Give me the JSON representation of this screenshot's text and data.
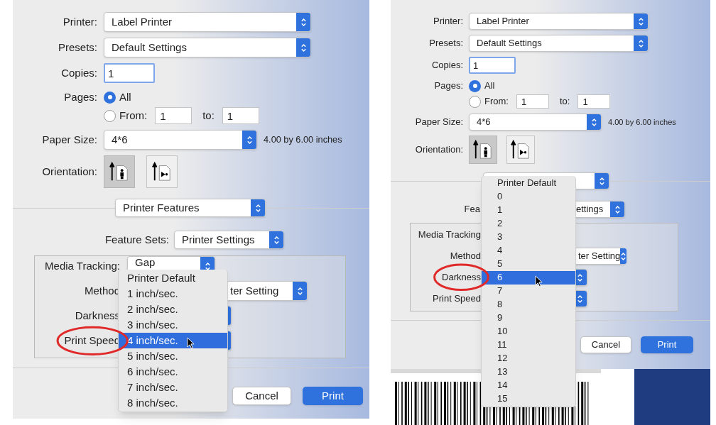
{
  "panels": [
    {
      "printer": {
        "label": "Printer:",
        "value": "Label Printer"
      },
      "presets": {
        "label": "Presets:",
        "value": "Default Settings"
      },
      "copies": {
        "label": "Copies:",
        "value": "1"
      },
      "pages": {
        "label": "Pages:",
        "options": [
          {
            "label": "All",
            "selected": true
          },
          {
            "label": "From:",
            "selected": false
          }
        ],
        "from": "1",
        "to_label": "to:",
        "to": "1"
      },
      "paper_size": {
        "label": "Paper Size:",
        "value": "4*6",
        "note": "4.00 by 6.00 inches"
      },
      "orientation": {
        "label": "Orientation:",
        "options": [
          {
            "kind": "portrait",
            "selected": true
          },
          {
            "kind": "landscape",
            "selected": false
          }
        ]
      },
      "section_popup": {
        "value": "Printer Features"
      },
      "feature_sets": {
        "label": "Feature Sets:",
        "value": "Printer Settings"
      },
      "settings": [
        {
          "label": "Media Tracking:",
          "value": "Gap",
          "circled": false
        },
        {
          "label": "Method",
          "value": "ter Setting",
          "circled": false
        },
        {
          "label": "Darkness",
          "circled": false
        },
        {
          "label": "Print Speed",
          "circled": true,
          "menu": {
            "items": [
              {
                "label": "Printer Default",
                "selected": false
              },
              {
                "label": "1 inch/sec.",
                "selected": false
              },
              {
                "label": "2 inch/sec.",
                "selected": false
              },
              {
                "label": "3 inch/sec.",
                "selected": false
              },
              {
                "label": "4 inch/sec.",
                "selected": true
              },
              {
                "label": "5 inch/sec.",
                "selected": false
              },
              {
                "label": "6 inch/sec.",
                "selected": false
              },
              {
                "label": "7 inch/sec.",
                "selected": false
              },
              {
                "label": "8 inch/sec.",
                "selected": false
              }
            ]
          }
        }
      ],
      "buttons": [
        {
          "label": "Cancel",
          "kind": "default"
        },
        {
          "label": "Print",
          "kind": "primary"
        }
      ],
      "preview": false
    },
    {
      "printer": {
        "label": "Printer:",
        "value": "Label Printer"
      },
      "presets": {
        "label": "Presets:",
        "value": "Default Settings"
      },
      "copies": {
        "label": "Copies:",
        "value": "1"
      },
      "pages": {
        "label": "Pages:",
        "options": [
          {
            "label": "All",
            "selected": true
          },
          {
            "label": "From:",
            "selected": false
          }
        ],
        "from": "1",
        "to_label": "to:",
        "to": "1"
      },
      "paper_size": {
        "label": "Paper Size:",
        "value": "4*6",
        "note": "4.00 by 6.00 inches"
      },
      "orientation": {
        "label": "Orientation:",
        "options": [
          {
            "kind": "portrait",
            "selected": true
          },
          {
            "kind": "landscape",
            "selected": false
          }
        ]
      },
      "feature_sets": {
        "label": "Fea",
        "value": "ettings"
      },
      "settings": [
        {
          "label": "Media Tracking",
          "circled": false
        },
        {
          "label": "Method",
          "value": "ter Setting",
          "circled": false
        },
        {
          "label": "Darkness",
          "circled": true,
          "menu": {
            "items": [
              {
                "label": "Printer Default",
                "selected": false
              },
              {
                "label": "0",
                "selected": false
              },
              {
                "label": "1",
                "selected": false
              },
              {
                "label": "2",
                "selected": false
              },
              {
                "label": "3",
                "selected": false
              },
              {
                "label": "4",
                "selected": false
              },
              {
                "label": "5",
                "selected": false
              },
              {
                "label": "6",
                "selected": true
              },
              {
                "label": "7",
                "selected": false
              },
              {
                "label": "8",
                "selected": false
              },
              {
                "label": "9",
                "selected": false
              },
              {
                "label": "10",
                "selected": false
              },
              {
                "label": "11",
                "selected": false
              },
              {
                "label": "12",
                "selected": false
              },
              {
                "label": "13",
                "selected": false
              },
              {
                "label": "14",
                "selected": false
              },
              {
                "label": "15",
                "selected": false
              }
            ]
          }
        },
        {
          "label": "Print Speed",
          "circled": false
        }
      ],
      "buttons": [
        {
          "label": "Cancel",
          "kind": "default"
        },
        {
          "label": "Print",
          "kind": "primary"
        }
      ],
      "preview": true
    }
  ]
}
